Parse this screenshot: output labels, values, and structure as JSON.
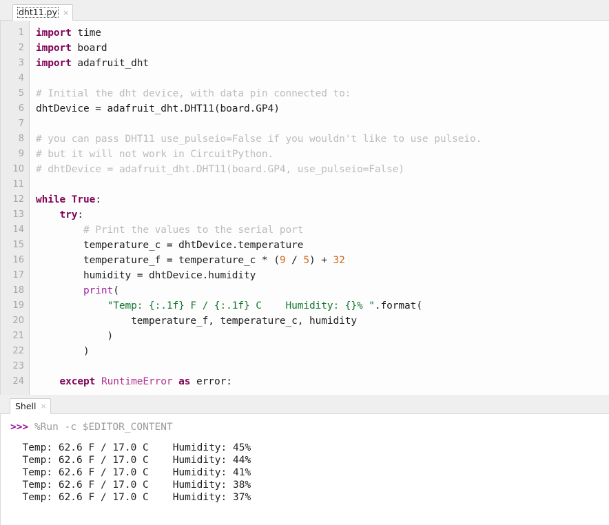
{
  "editor": {
    "tab": {
      "label": "dht11.py",
      "close_icon": "close-icon",
      "close_glyph": "×"
    },
    "lines": [
      {
        "n": "1",
        "tokens": [
          {
            "t": "import",
            "c": "kw"
          },
          {
            "t": " time",
            "c": "pl"
          }
        ]
      },
      {
        "n": "2",
        "tokens": [
          {
            "t": "import",
            "c": "kw"
          },
          {
            "t": " board",
            "c": "pl"
          }
        ]
      },
      {
        "n": "3",
        "tokens": [
          {
            "t": "import",
            "c": "kw"
          },
          {
            "t": " adafruit_dht",
            "c": "pl"
          }
        ]
      },
      {
        "n": "4",
        "tokens": [
          {
            "t": "",
            "c": "pl"
          }
        ]
      },
      {
        "n": "5",
        "tokens": [
          {
            "t": "# Initial the dht device, with data pin connected to:",
            "c": "cmt"
          }
        ]
      },
      {
        "n": "6",
        "tokens": [
          {
            "t": "dhtDevice = adafruit_dht.DHT11(board.GP4)",
            "c": "pl"
          }
        ]
      },
      {
        "n": "7",
        "tokens": [
          {
            "t": "",
            "c": "pl"
          }
        ]
      },
      {
        "n": "8",
        "tokens": [
          {
            "t": "# you can pass DHT11 use_pulseio=False if you wouldn't like to use pulseio.",
            "c": "cmt"
          }
        ]
      },
      {
        "n": "9",
        "tokens": [
          {
            "t": "# but it will not work in CircuitPython.",
            "c": "cmt"
          }
        ]
      },
      {
        "n": "10",
        "tokens": [
          {
            "t": "# dhtDevice = adafruit_dht.DHT11(board.GP4, use_pulseio=False)",
            "c": "cmt"
          }
        ]
      },
      {
        "n": "11",
        "tokens": [
          {
            "t": "",
            "c": "pl"
          }
        ]
      },
      {
        "n": "12",
        "tokens": [
          {
            "t": "while",
            "c": "kw"
          },
          {
            "t": " ",
            "c": "pl"
          },
          {
            "t": "True",
            "c": "kw"
          },
          {
            "t": ":",
            "c": "pl"
          }
        ]
      },
      {
        "n": "13",
        "tokens": [
          {
            "t": "    ",
            "c": "pl"
          },
          {
            "t": "try",
            "c": "kw"
          },
          {
            "t": ":",
            "c": "pl"
          }
        ]
      },
      {
        "n": "14",
        "tokens": [
          {
            "t": "        # Print the values to the serial port",
            "c": "cmt"
          }
        ]
      },
      {
        "n": "15",
        "tokens": [
          {
            "t": "        temperature_c = dhtDevice.temperature",
            "c": "pl"
          }
        ]
      },
      {
        "n": "16",
        "tokens": [
          {
            "t": "        temperature_f = temperature_c * (",
            "c": "pl"
          },
          {
            "t": "9",
            "c": "num"
          },
          {
            "t": " / ",
            "c": "pl"
          },
          {
            "t": "5",
            "c": "num"
          },
          {
            "t": ") + ",
            "c": "pl"
          },
          {
            "t": "32",
            "c": "num"
          }
        ]
      },
      {
        "n": "17",
        "tokens": [
          {
            "t": "        humidity = dhtDevice.humidity",
            "c": "pl"
          }
        ]
      },
      {
        "n": "18",
        "tokens": [
          {
            "t": "        ",
            "c": "pl"
          },
          {
            "t": "print",
            "c": "builtin"
          },
          {
            "t": "(",
            "c": "pl"
          }
        ]
      },
      {
        "n": "19",
        "tokens": [
          {
            "t": "            ",
            "c": "pl"
          },
          {
            "t": "\"Temp: {:.1f} F / {:.1f} C    Humidity: {}% \"",
            "c": "str"
          },
          {
            "t": ".format(",
            "c": "pl"
          }
        ]
      },
      {
        "n": "20",
        "tokens": [
          {
            "t": "                temperature_f, temperature_c, humidity",
            "c": "pl"
          }
        ]
      },
      {
        "n": "21",
        "tokens": [
          {
            "t": "            )",
            "c": "pl"
          }
        ]
      },
      {
        "n": "22",
        "tokens": [
          {
            "t": "        )",
            "c": "pl"
          }
        ]
      },
      {
        "n": "23",
        "tokens": [
          {
            "t": "",
            "c": "pl"
          }
        ]
      },
      {
        "n": "24",
        "tokens": [
          {
            "t": "    ",
            "c": "pl"
          },
          {
            "t": "except",
            "c": "kw"
          },
          {
            "t": " ",
            "c": "pl"
          },
          {
            "t": "RuntimeError",
            "c": "excname"
          },
          {
            "t": " ",
            "c": "pl"
          },
          {
            "t": "as",
            "c": "kw"
          },
          {
            "t": " error:",
            "c": "pl"
          }
        ]
      }
    ]
  },
  "shell": {
    "tab": {
      "label": "Shell",
      "close_icon": "close-icon",
      "close_glyph": "×"
    },
    "prompt": ">>>",
    "command": "%Run -c $EDITOR_CONTENT",
    "output": [
      "  Temp: 62.6 F / 17.0 C    Humidity: 45%",
      "  Temp: 62.6 F / 17.0 C    Humidity: 44%",
      "  Temp: 62.6 F / 17.0 C    Humidity: 41%",
      "  Temp: 62.6 F / 17.0 C    Humidity: 38%",
      "  Temp: 62.6 F / 17.0 C    Humidity: 37%"
    ]
  },
  "colors": {
    "keyword": "#7f0055",
    "builtin": "#a020a0",
    "exception": "#b5318f",
    "comment": "#bcbcbc",
    "string": "#13792e",
    "number": "#d2691e",
    "prompt": "#a0149c",
    "gutter_bg": "#ececec",
    "editor_bg": "#fdfdfd"
  }
}
